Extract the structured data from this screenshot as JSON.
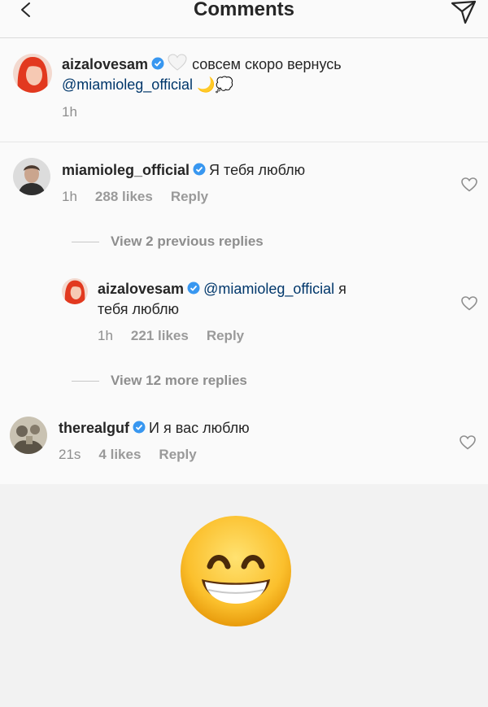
{
  "header": {
    "title": "Comments",
    "back_icon": "chevron-left-icon",
    "send_icon": "paper-plane-icon"
  },
  "caption": {
    "username": "aizalovesam",
    "text": "совсем скоро вернусь",
    "mention": "@miamioleg_official",
    "emojis": "🌙💭",
    "time": "1h"
  },
  "comments": [
    {
      "username": "miamioleg_official",
      "text": "Я тебя люблю",
      "time": "1h",
      "likes": "288 likes",
      "reply": "Reply"
    },
    {
      "username": "aizalovesam",
      "mention": "@miamioleg_official",
      "text_line1": "я",
      "text_line2": "тебя люблю",
      "time": "1h",
      "likes": "221 likes",
      "reply": "Reply"
    },
    {
      "username": "therealguf",
      "text": "И я вас люблю",
      "time": "21s",
      "likes": "4 likes",
      "reply": "Reply"
    }
  ],
  "view_previous": "View 2 previous replies",
  "view_more": "View 12 more replies",
  "big_emoji": "grinning-face-with-smiling-eyes",
  "colors": {
    "mention": "#00376b",
    "verified": "#3897f0",
    "meta": "#8e8e8e"
  }
}
